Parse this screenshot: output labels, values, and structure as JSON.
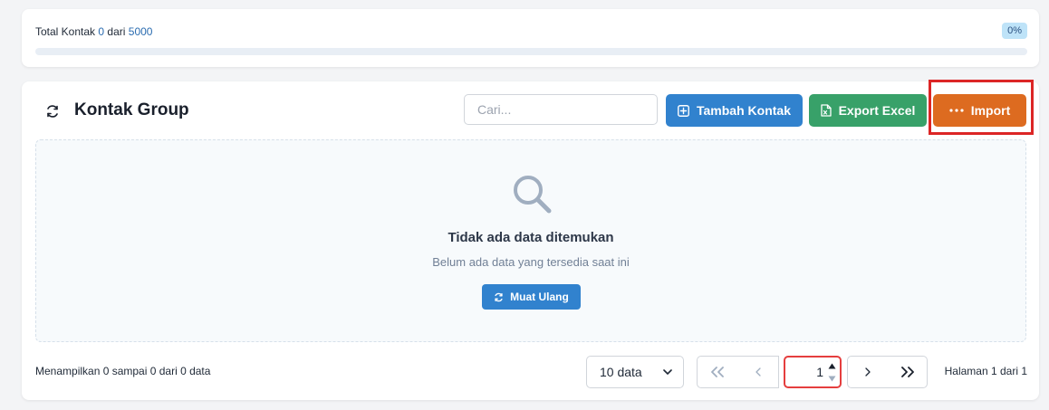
{
  "stats": {
    "total_label": "Total Kontak",
    "used": "0",
    "of_label": "dari",
    "limit": "5000",
    "percent_label": "0%",
    "progress_fraction": 0
  },
  "header": {
    "title": "Kontak Group",
    "search_placeholder": "Cari...",
    "add_label": "Tambah Kontak",
    "export_label": "Export Excel",
    "import_label": "Import"
  },
  "empty_state": {
    "title": "Tidak ada data ditemukan",
    "subtitle": "Belum ada data yang tersedia saat ini",
    "reload_label": "Muat Ulang"
  },
  "footer": {
    "showing_text": "Menampilkan 0 sampai 0 dari 0 data",
    "per_page_value": "10 data",
    "current_page": "1",
    "page_info": "Halaman 1 dari 1"
  },
  "colors": {
    "primary": "#3182ce",
    "success": "#38a169",
    "warning": "#dd6b20",
    "highlight": "#dc2626"
  }
}
